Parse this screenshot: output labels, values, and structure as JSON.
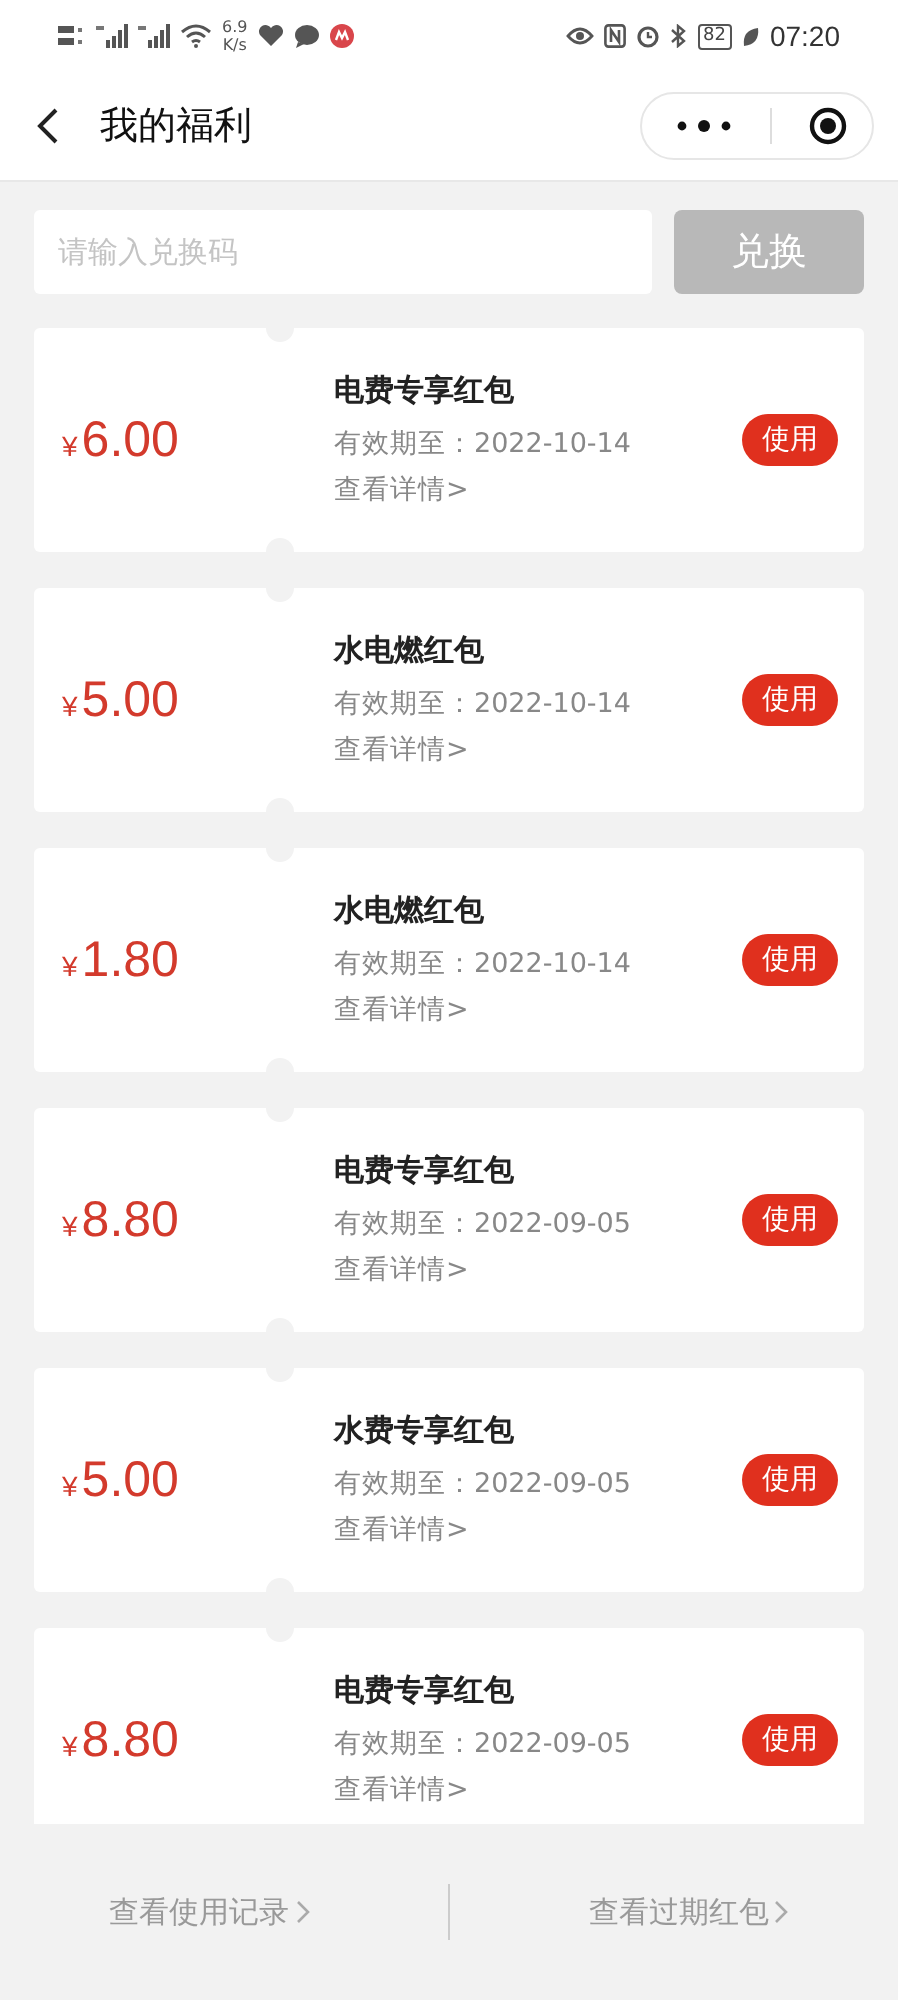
{
  "status_bar": {
    "speed_value": "6.9",
    "speed_unit": "K/s",
    "battery": "82",
    "time": "07:20"
  },
  "header": {
    "title": "我的福利"
  },
  "redeem": {
    "placeholder": "请输入兑换码",
    "button": "兑换"
  },
  "coupons": [
    {
      "currency": "¥",
      "amount": "6.00",
      "title": "电费专享红包",
      "expiry": "有效期至：2022-10-14",
      "details": "查看详情>",
      "action": "使用"
    },
    {
      "currency": "¥",
      "amount": "5.00",
      "title": "水电燃红包",
      "expiry": "有效期至：2022-10-14",
      "details": "查看详情>",
      "action": "使用"
    },
    {
      "currency": "¥",
      "amount": "1.80",
      "title": "水电燃红包",
      "expiry": "有效期至：2022-10-14",
      "details": "查看详情>",
      "action": "使用"
    },
    {
      "currency": "¥",
      "amount": "8.80",
      "title": "电费专享红包",
      "expiry": "有效期至：2022-09-05",
      "details": "查看详情>",
      "action": "使用"
    },
    {
      "currency": "¥",
      "amount": "5.00",
      "title": "水费专享红包",
      "expiry": "有效期至：2022-09-05",
      "details": "查看详情>",
      "action": "使用"
    },
    {
      "currency": "¥",
      "amount": "8.80",
      "title": "电费专享红包",
      "expiry": "有效期至：2022-09-05",
      "details": "查看详情>",
      "action": "使用"
    }
  ],
  "footer": {
    "links": [
      "查看使用记录",
      "查看过期红包"
    ]
  }
}
